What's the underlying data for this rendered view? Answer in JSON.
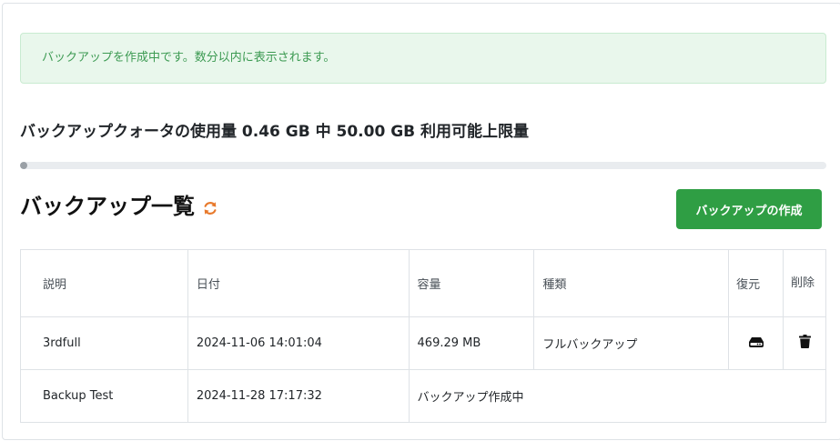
{
  "alert": {
    "message": "バックアップを作成中です。数分以内に表示されます。"
  },
  "quota": {
    "title": "バックアップクォータの使用量 0.46 GB 中 50.00 GB 利用可能上限量",
    "used_fraction": 0.0092
  },
  "backup_list": {
    "title": "バックアップ一覧",
    "refresh_icon": "refresh-icon",
    "create_button_label": "バックアップの作成",
    "columns": {
      "description": "説明",
      "date": "日付",
      "size": "容量",
      "type": "種類",
      "restore": "復元",
      "delete": "削除"
    },
    "rows": [
      {
        "description": "3rdfull",
        "date": "2024-11-06 14:01:04",
        "size": "469.29 MB",
        "type": "フルバックアップ",
        "restore_icon": "hard-drive-icon",
        "delete_icon": "trash-icon"
      },
      {
        "description": "Backup Test",
        "date": "2024-11-28 17:17:32",
        "status": "バックアップ作成中"
      }
    ]
  },
  "colors": {
    "alert_bg": "#e9f7ec",
    "alert_text": "#3c9a52",
    "primary_button": "#2f9e44",
    "refresh_icon": "#e8792b"
  }
}
